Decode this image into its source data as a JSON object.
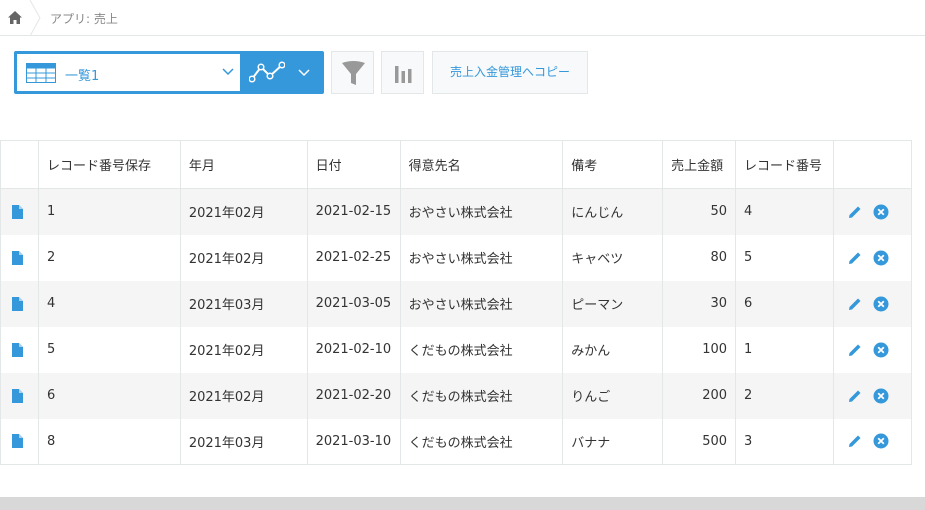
{
  "breadcrumb": {
    "text": "アプリ: 売上"
  },
  "toolbar": {
    "view_name": "一覧1",
    "copy_label": "売上入金管理へコピー"
  },
  "table": {
    "columns": [
      "",
      "レコード番号保存",
      "年月",
      "日付",
      "得意先名",
      "備考",
      "売上金額",
      "レコード番号",
      ""
    ],
    "rows": [
      {
        "saved_no": "1",
        "month": "2021年02月",
        "date": "2021-02-15",
        "customer": "おやさい株式会社",
        "note": "にんじん",
        "amount": "50",
        "record_no": "4"
      },
      {
        "saved_no": "2",
        "month": "2021年02月",
        "date": "2021-02-25",
        "customer": "おやさい株式会社",
        "note": "キャベツ",
        "amount": "80",
        "record_no": "5"
      },
      {
        "saved_no": "4",
        "month": "2021年03月",
        "date": "2021-03-05",
        "customer": "おやさい株式会社",
        "note": "ピーマン",
        "amount": "30",
        "record_no": "6"
      },
      {
        "saved_no": "5",
        "month": "2021年02月",
        "date": "2021-02-10",
        "customer": "くだもの株式会社",
        "note": "みかん",
        "amount": "100",
        "record_no": "1"
      },
      {
        "saved_no": "6",
        "month": "2021年02月",
        "date": "2021-02-20",
        "customer": "くだもの株式会社",
        "note": "りんご",
        "amount": "200",
        "record_no": "2"
      },
      {
        "saved_no": "8",
        "month": "2021年03月",
        "date": "2021-03-10",
        "customer": "くだもの株式会社",
        "note": "バナナ",
        "amount": "500",
        "record_no": "3"
      }
    ]
  },
  "colors": {
    "accent": "#3498db",
    "row_alt": "#f5f5f5",
    "border": "#e3e7e8"
  },
  "icons": [
    "home-icon",
    "table-view-icon",
    "chevron-down-icon",
    "graph-icon",
    "filter-icon",
    "bar-chart-icon",
    "document-icon",
    "edit-icon",
    "delete-icon"
  ]
}
